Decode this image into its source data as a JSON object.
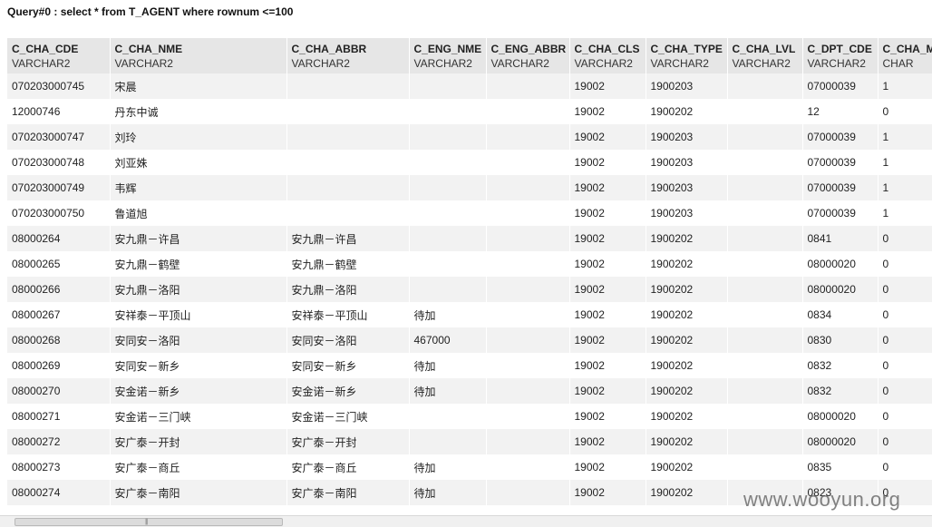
{
  "query": {
    "title": "Query#0 : select * from T_AGENT where rownum <=100"
  },
  "columns": [
    {
      "name": "C_CHA_CDE",
      "type": "VARCHAR2"
    },
    {
      "name": "C_CHA_NME",
      "type": "VARCHAR2"
    },
    {
      "name": "C_CHA_ABBR",
      "type": "VARCHAR2"
    },
    {
      "name": "C_ENG_NME",
      "type": "VARCHAR2"
    },
    {
      "name": "C_ENG_ABBR",
      "type": "VARCHAR2"
    },
    {
      "name": "C_CHA_CLS",
      "type": "VARCHAR2"
    },
    {
      "name": "C_CHA_TYPE",
      "type": "VARCHAR2"
    },
    {
      "name": "C_CHA_LVL",
      "type": "VARCHAR2"
    },
    {
      "name": "C_DPT_CDE",
      "type": "VARCHAR2"
    },
    {
      "name": "C_CHA_M",
      "type": "CHAR"
    }
  ],
  "rows": [
    [
      "070203000745",
      "宋晨",
      "",
      "",
      "",
      "19002",
      "1900203",
      "",
      "07000039",
      "1"
    ],
    [
      "12000746",
      "丹东中诚",
      "",
      "",
      "",
      "19002",
      "1900202",
      "",
      "12",
      "0"
    ],
    [
      "070203000747",
      "刘玲",
      "",
      "",
      "",
      "19002",
      "1900203",
      "",
      "07000039",
      "1"
    ],
    [
      "070203000748",
      "刘亚姝",
      "",
      "",
      "",
      "19002",
      "1900203",
      "",
      "07000039",
      "1"
    ],
    [
      "070203000749",
      "韦辉",
      "",
      "",
      "",
      "19002",
      "1900203",
      "",
      "07000039",
      "1"
    ],
    [
      "070203000750",
      "鲁道旭",
      "",
      "",
      "",
      "19002",
      "1900203",
      "",
      "07000039",
      "1"
    ],
    [
      "08000264",
      "安九鼎－许昌",
      "安九鼎－许昌",
      "",
      "",
      "19002",
      "1900202",
      "",
      "0841",
      "0"
    ],
    [
      "08000265",
      "安九鼎－鹤壁",
      "安九鼎－鹤壁",
      "",
      "",
      "19002",
      "1900202",
      "",
      "08000020",
      "0"
    ],
    [
      "08000266",
      "安九鼎－洛阳",
      "安九鼎－洛阳",
      "",
      "",
      "19002",
      "1900202",
      "",
      "08000020",
      "0"
    ],
    [
      "08000267",
      "安祥泰－平顶山",
      "安祥泰－平顶山",
      "待加",
      "",
      "19002",
      "1900202",
      "",
      "0834",
      "0"
    ],
    [
      "08000268",
      "安同安－洛阳",
      "安同安－洛阳",
      "467000",
      "",
      "19002",
      "1900202",
      "",
      "0830",
      "0"
    ],
    [
      "08000269",
      "安同安－新乡",
      "安同安－新乡",
      "待加",
      "",
      "19002",
      "1900202",
      "",
      "0832",
      "0"
    ],
    [
      "08000270",
      "安金诺－新乡",
      "安金诺－新乡",
      "待加",
      "",
      "19002",
      "1900202",
      "",
      "0832",
      "0"
    ],
    [
      "08000271",
      "安金诺－三门峡",
      "安金诺－三门峡",
      "",
      "",
      "19002",
      "1900202",
      "",
      "08000020",
      "0"
    ],
    [
      "08000272",
      "安广泰－开封",
      "安广泰－开封",
      "",
      "",
      "19002",
      "1900202",
      "",
      "08000020",
      "0"
    ],
    [
      "08000273",
      "安广泰－商丘",
      "安广泰－商丘",
      "待加",
      "",
      "19002",
      "1900202",
      "",
      "0835",
      "0"
    ],
    [
      "08000274",
      "安广泰－南阳",
      "安广泰－南阳",
      "待加",
      "",
      "19002",
      "1900202",
      "",
      "0823",
      "0"
    ]
  ],
  "scrollbar": {
    "grip": "|||"
  },
  "watermark": "www.wooyun.org"
}
